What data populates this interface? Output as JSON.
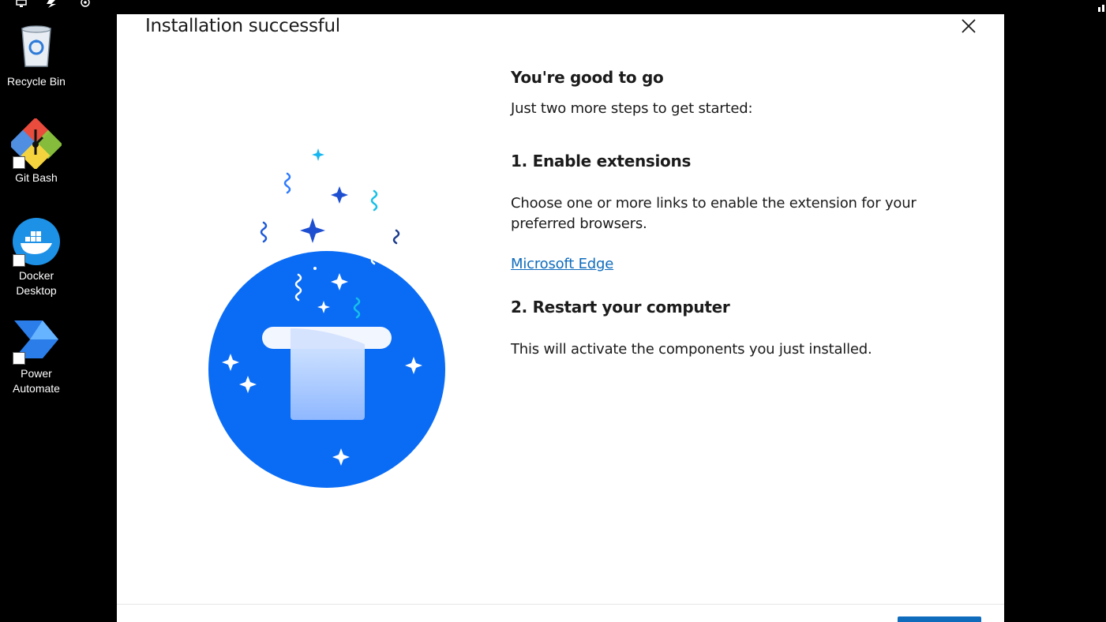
{
  "taskbar_icons": [
    "monitor-icon",
    "lightning-icon",
    "settings-icon"
  ],
  "desktop": {
    "icons": [
      {
        "label": "Recycle Bin",
        "icon": "recycle-bin-icon"
      },
      {
        "label": "Git Bash",
        "icon": "git-bash-icon"
      },
      {
        "label": "Docker Desktop",
        "icon": "docker-icon"
      },
      {
        "label": "Power Automate",
        "icon": "power-automate-icon"
      }
    ]
  },
  "dialog": {
    "title": "Installation successful",
    "heading": "You're good to go",
    "intro": "Just two more steps to get started:",
    "step1": {
      "title": "1. Enable extensions",
      "description": "Choose one or more links to enable the extension for your preferred browsers.",
      "links": [
        "Microsoft Edge"
      ]
    },
    "step2": {
      "title": "2. Restart your computer",
      "description": "This will activate the components you just installed."
    }
  },
  "colors": {
    "accent": "#0f6cbd",
    "illustration_blue": "#0a6cf5"
  }
}
